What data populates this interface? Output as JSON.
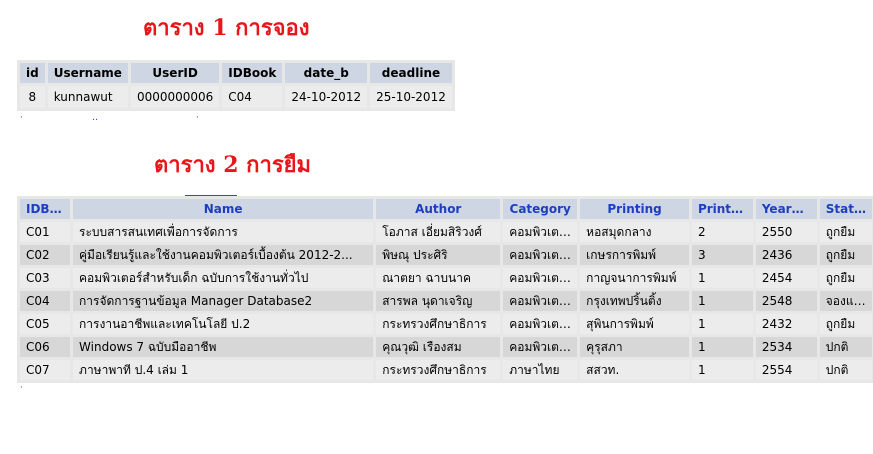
{
  "table1": {
    "title": "ตาราง 1 การจอง",
    "headers": [
      "id",
      "Username",
      "UserID",
      "IDBook",
      "date_b",
      "deadline"
    ],
    "rows": [
      [
        "8",
        "kunnawut",
        "0000000006",
        "C04",
        "24-10-2012",
        "25-10-2012"
      ]
    ]
  },
  "table2": {
    "title": "ตาราง 2 การยืม",
    "headers": [
      "IDBook",
      "Name",
      "Author",
      "Category",
      "Printing",
      "PrintNum",
      "YearPrint",
      "Status"
    ],
    "rows": [
      [
        "C01",
        "ระบบสารสนเทศเพื่อการจัดการ",
        "โอภาส เอี่ยมสิริวงศ์",
        "คอมพิวเตอร์",
        "หอสมุดกลาง",
        "2",
        "2550",
        "ถูกยืม"
      ],
      [
        "C02",
        "คู่มือเรียนรู้และใช้งานคอมพิวเตอร์เบื้องต้น 2012-2...",
        "พิษณุ ประศิริ",
        "คอมพิวเตอร์",
        "เกษรการพิมพ์",
        "3",
        "2436",
        "ถูกยืม"
      ],
      [
        "C03",
        "คอมพิวเตอร์สำหรับเด็ก ฉบับการใช้งานทั่วไป",
        "ณาตยา ฉาบนาค",
        "คอมพิวเตอร์",
        "กาญจนาการพิมพ์",
        "1",
        "2454",
        "ถูกยืม"
      ],
      [
        "C04",
        "การจัดการฐานข้อมูล Manager Database2",
        "สารพล นุดาเจริญ",
        "คอมพิวเตอร์",
        "กรุงเทพปริ้นติ้ง",
        "1",
        "2548",
        "จองแล้ว"
      ],
      [
        "C05",
        "การงานอาชีพและเทคโนโลยี ป.2",
        "กระทรวงศึกษาธิการ",
        "คอมพิวเตอร์",
        "สุพินการพิมพ์",
        "1",
        "2432",
        "ถูกยืม"
      ],
      [
        "C06",
        "Windows 7 ฉบับมืออาชีพ",
        "คุณวุฒิ เรืองสม",
        "คอมพิวเตอร์",
        "คุรุสภา",
        "1",
        "2534",
        "ปกติ"
      ],
      [
        "C07",
        "ภาษาพาที ป.4 เล่ม 1",
        "กระทรวงศึกษาธิการ",
        "ภาษาไทย",
        "สสวท.",
        "1",
        "2554",
        "ปกติ"
      ]
    ]
  }
}
